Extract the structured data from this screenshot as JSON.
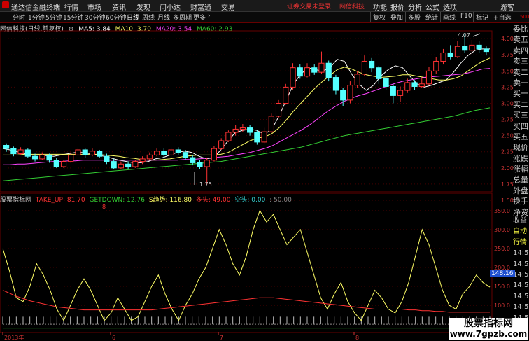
{
  "menubar": {
    "app_title": "通达信金融终端",
    "items": [
      "行情",
      "市场",
      "资讯",
      "发现",
      "问小达",
      "财富通",
      "交易"
    ],
    "notice": "证券交易未登录",
    "broker": "网信科技",
    "right_items": [
      "功能",
      "报价",
      "分析",
      "公式",
      "选项"
    ],
    "guest": "游客"
  },
  "toolbar": {
    "periods": [
      "分时",
      "1分钟",
      "5分钟",
      "15分钟",
      "30分钟",
      "60分钟",
      "日线",
      "周线",
      "月线",
      "多周期",
      "更多"
    ],
    "active_period": "日线",
    "right_buttons": [
      "复权",
      "叠加",
      "多股",
      "统计",
      "画线",
      "F10",
      "标记",
      "+自选"
    ]
  },
  "main_legend": {
    "title": "网信科技(日线,前复权)",
    "ma": [
      {
        "label": "MA5: 3.84",
        "color": "#ffffff"
      },
      {
        "label": "MA10: 3.70",
        "color": "#ffff66"
      },
      {
        "label": "MA20: 3.54",
        "color": "#ff44ff"
      },
      {
        "label": "MA60: 2.93",
        "color": "#33cc33"
      }
    ]
  },
  "price_axis": [
    "4.00",
    "3.75",
    "3.50",
    "3.25",
    "3.00",
    "2.75",
    "2.50",
    "2.25",
    "2.00",
    "1.75",
    "1.50"
  ],
  "price_annotations": {
    "high": "4.07",
    "low": "1.75"
  },
  "side_labels": [
    "委比",
    "卖五",
    "卖四",
    "卖三",
    "卖二",
    "卖一",
    "买一",
    "买二",
    "买三",
    "买四",
    "买五",
    "现价",
    "涨跌",
    "涨幅",
    "总量",
    "外盘",
    "换手",
    "净资",
    "收益"
  ],
  "side_labels_lower": [
    "自动",
    "行情",
    "14:5",
    "14:5",
    "14:5",
    "14:5",
    "14:5",
    "14:5",
    "14:5",
    "14:5"
  ],
  "top_right_mark": "500",
  "indicator_legend": {
    "name": "股票指标网",
    "items": [
      {
        "label": "TAKE_UP: 81.70",
        "color": "#ff3333"
      },
      {
        "label": "GETDOWN: 12.76",
        "color": "#33cc33"
      },
      {
        "label": "S趋势: 116.80",
        "color": "#ffff66"
      },
      {
        "label": "多头: 49.00",
        "color": "#ff3333"
      },
      {
        "label": "空头: 0.00",
        "color": "#33cccc"
      },
      {
        "label": ": 50.00",
        "color": "#888888"
      }
    ]
  },
  "indicator_axis": [
    "350.0",
    "300.0",
    "250.0",
    "200.0",
    "150.0",
    "100.0",
    "50.0"
  ],
  "indicator_current": "148.16",
  "time_axis": [
    "2013年",
    "6",
    "7",
    "8"
  ],
  "red_mark": "8",
  "watermark": {
    "line1": "股票指标网",
    "line2": "www.7gpzb.com"
  },
  "chart_data": [
    {
      "type": "candlestick",
      "title": "网信科技(日线,前复权)",
      "ylim": [
        1.5,
        4.1
      ],
      "series": [
        {
          "name": "MA5",
          "values": [
            2.3,
            2.28,
            2.25,
            2.22,
            2.2,
            2.2,
            2.19,
            2.18,
            2.2,
            2.22,
            2.24,
            2.24,
            2.22,
            2.2,
            2.18,
            2.15,
            2.12,
            2.1,
            2.08,
            2.08,
            2.1,
            2.14,
            2.16,
            2.2,
            2.24,
            2.26,
            2.24,
            2.18,
            2.14,
            2.16,
            2.28,
            2.42,
            2.55,
            2.58,
            2.6,
            2.58,
            2.52,
            2.6,
            2.8,
            3.05,
            3.3,
            3.45,
            3.55,
            3.52,
            3.5,
            3.55,
            3.68,
            3.65,
            3.45,
            3.3,
            3.2,
            3.28,
            3.42,
            3.52,
            3.58,
            3.55,
            3.42,
            3.3,
            3.25,
            3.28,
            3.32,
            3.36,
            3.48,
            3.62,
            3.74,
            3.82,
            3.84,
            3.84
          ]
        },
        {
          "name": "MA10",
          "values": [
            2.2,
            2.2,
            2.2,
            2.21,
            2.21,
            2.21,
            2.21,
            2.21,
            2.21,
            2.21,
            2.21,
            2.21,
            2.21,
            2.21,
            2.2,
            2.19,
            2.18,
            2.16,
            2.15,
            2.13,
            2.12,
            2.12,
            2.13,
            2.14,
            2.16,
            2.18,
            2.19,
            2.2,
            2.2,
            2.2,
            2.21,
            2.24,
            2.3,
            2.36,
            2.42,
            2.46,
            2.48,
            2.53,
            2.62,
            2.74,
            2.88,
            3.0,
            3.12,
            3.24,
            3.34,
            3.43,
            3.52,
            3.56,
            3.53,
            3.48,
            3.44,
            3.42,
            3.4,
            3.41,
            3.42,
            3.44,
            3.44,
            3.42,
            3.4,
            3.38,
            3.36,
            3.36,
            3.38,
            3.42,
            3.5,
            3.58,
            3.65,
            3.7
          ]
        },
        {
          "name": "MA20",
          "values": [
            2.05,
            2.05,
            2.06,
            2.06,
            2.07,
            2.08,
            2.09,
            2.1,
            2.1,
            2.11,
            2.11,
            2.12,
            2.12,
            2.12,
            2.12,
            2.12,
            2.12,
            2.12,
            2.12,
            2.12,
            2.12,
            2.12,
            2.12,
            2.12,
            2.12,
            2.13,
            2.13,
            2.14,
            2.15,
            2.16,
            2.17,
            2.18,
            2.2,
            2.22,
            2.24,
            2.27,
            2.3,
            2.34,
            2.4,
            2.46,
            2.52,
            2.58,
            2.65,
            2.73,
            2.82,
            2.9,
            2.97,
            3.03,
            3.08,
            3.12,
            3.15,
            3.19,
            3.23,
            3.27,
            3.31,
            3.34,
            3.36,
            3.38,
            3.4,
            3.41,
            3.42,
            3.43,
            3.44,
            3.45,
            3.47,
            3.5,
            3.53,
            3.54
          ]
        },
        {
          "name": "MA60",
          "values": [
            1.8,
            1.81,
            1.82,
            1.83,
            1.84,
            1.85,
            1.86,
            1.87,
            1.88,
            1.89,
            1.9,
            1.91,
            1.92,
            1.93,
            1.94,
            1.95,
            1.96,
            1.97,
            1.98,
            1.99,
            2.0,
            2.01,
            2.02,
            2.03,
            2.04,
            2.05,
            2.06,
            2.07,
            2.08,
            2.09,
            2.1,
            2.12,
            2.14,
            2.16,
            2.18,
            2.2,
            2.22,
            2.24,
            2.26,
            2.28,
            2.3,
            2.32,
            2.35,
            2.38,
            2.41,
            2.44,
            2.47,
            2.5,
            2.52,
            2.54,
            2.56,
            2.58,
            2.6,
            2.62,
            2.64,
            2.66,
            2.68,
            2.7,
            2.72,
            2.74,
            2.76,
            2.78,
            2.8,
            2.83,
            2.86,
            2.89,
            2.91,
            2.93
          ]
        }
      ],
      "candles": [
        [
          2.35,
          2.3,
          2.38,
          2.25
        ],
        [
          2.3,
          2.22,
          2.33,
          2.18
        ],
        [
          2.22,
          2.28,
          2.32,
          2.2
        ],
        [
          2.28,
          2.18,
          2.3,
          2.15
        ],
        [
          2.18,
          2.14,
          2.22,
          2.1
        ],
        [
          2.14,
          2.2,
          2.24,
          2.12
        ],
        [
          2.2,
          2.12,
          2.22,
          2.08
        ],
        [
          2.12,
          2.02,
          2.15,
          2.0
        ],
        [
          2.02,
          2.1,
          2.12,
          2.0
        ],
        [
          2.1,
          2.2,
          2.24,
          2.08
        ],
        [
          2.2,
          2.28,
          2.32,
          2.18
        ],
        [
          2.28,
          2.2,
          2.3,
          2.16
        ],
        [
          2.2,
          2.26,
          2.3,
          2.18
        ],
        [
          2.26,
          2.18,
          2.28,
          2.15
        ],
        [
          2.18,
          2.1,
          2.22,
          2.06
        ],
        [
          2.1,
          2.0,
          2.14,
          1.98
        ],
        [
          2.0,
          2.06,
          2.1,
          1.98
        ],
        [
          2.06,
          2.02,
          2.1,
          1.98
        ],
        [
          2.02,
          2.1,
          2.12,
          2.0
        ],
        [
          2.1,
          2.14,
          2.18,
          2.06
        ],
        [
          2.14,
          2.2,
          2.24,
          2.12
        ],
        [
          2.2,
          2.26,
          2.3,
          2.18
        ],
        [
          2.26,
          2.2,
          2.3,
          2.16
        ],
        [
          2.2,
          2.28,
          2.32,
          2.18
        ],
        [
          2.28,
          2.24,
          2.32,
          2.2
        ],
        [
          2.24,
          2.16,
          2.28,
          2.12
        ],
        [
          2.16,
          2.08,
          2.2,
          2.04
        ],
        [
          2.08,
          2.02,
          2.12,
          1.98
        ],
        [
          2.02,
          2.12,
          2.15,
          1.75
        ],
        [
          2.12,
          2.3,
          2.34,
          2.1
        ],
        [
          2.3,
          2.42,
          2.46,
          2.28
        ],
        [
          2.42,
          2.55,
          2.58,
          2.4
        ],
        [
          2.55,
          2.6,
          2.66,
          2.5
        ],
        [
          2.6,
          2.62,
          2.68,
          2.56
        ],
        [
          2.62,
          2.55,
          2.66,
          2.5
        ],
        [
          2.55,
          2.4,
          2.58,
          2.36
        ],
        [
          2.4,
          2.56,
          2.62,
          2.38
        ],
        [
          2.56,
          2.8,
          2.84,
          2.54
        ],
        [
          2.8,
          3.0,
          3.05,
          2.78
        ],
        [
          3.0,
          3.25,
          3.3,
          2.98
        ],
        [
          3.25,
          3.55,
          3.62,
          3.2
        ],
        [
          3.55,
          3.42,
          3.6,
          3.38
        ],
        [
          3.42,
          3.55,
          3.62,
          3.4
        ],
        [
          3.55,
          3.48,
          3.6,
          3.44
        ],
        [
          3.48,
          3.62,
          3.8,
          3.46
        ],
        [
          3.62,
          3.4,
          3.66,
          3.34
        ],
        [
          3.4,
          3.2,
          3.44,
          3.14
        ],
        [
          3.2,
          3.05,
          3.24,
          2.96
        ],
        [
          3.05,
          3.28,
          3.34,
          3.0
        ],
        [
          3.28,
          3.45,
          3.5,
          3.24
        ],
        [
          3.45,
          3.65,
          3.74,
          3.42
        ],
        [
          3.65,
          3.55,
          3.7,
          3.48
        ],
        [
          3.55,
          3.38,
          3.58,
          3.3
        ],
        [
          3.38,
          3.26,
          3.42,
          3.2
        ],
        [
          3.26,
          3.12,
          3.3,
          3.0
        ],
        [
          3.12,
          3.2,
          3.26,
          3.02
        ],
        [
          3.2,
          3.32,
          3.38,
          3.16
        ],
        [
          3.32,
          3.26,
          3.36,
          3.2
        ],
        [
          3.26,
          3.3,
          3.4,
          3.24
        ],
        [
          3.3,
          3.5,
          3.56,
          3.28
        ],
        [
          3.5,
          3.65,
          3.72,
          3.46
        ],
        [
          3.65,
          3.78,
          3.84,
          3.6
        ],
        [
          3.78,
          3.72,
          3.9,
          3.68
        ],
        [
          3.72,
          3.88,
          3.96,
          3.7
        ],
        [
          3.88,
          3.82,
          4.07,
          3.78
        ],
        [
          3.82,
          3.9,
          3.98,
          3.76
        ],
        [
          3.9,
          3.84,
          3.96,
          3.78
        ],
        [
          3.84,
          3.8,
          3.88,
          3.74
        ]
      ]
    },
    {
      "type": "line",
      "title": "股票指标网",
      "ylim": [
        30,
        370
      ],
      "series": [
        {
          "name": "S趋势",
          "values": [
            250,
            190,
            120,
            110,
            150,
            210,
            180,
            140,
            90,
            60,
            100,
            140,
            170,
            140,
            100,
            60,
            80,
            120,
            90,
            60,
            70,
            110,
            150,
            180,
            130,
            90,
            60,
            100,
            130,
            170,
            200,
            250,
            300,
            260,
            210,
            180,
            230,
            300,
            350,
            320,
            340,
            300,
            260,
            280,
            300,
            240,
            180,
            120,
            90,
            130,
            160,
            110,
            80,
            60,
            100,
            140,
            120,
            90,
            80,
            110,
            160,
            230,
            300,
            260,
            200,
            140,
            100,
            90,
            130,
            150,
            180,
            160,
            148
          ]
        },
        {
          "name": "TAKE_UP",
          "values": [
            140,
            132,
            124,
            118,
            112,
            108,
            104,
            100,
            96,
            94,
            92,
            90,
            88,
            88,
            88,
            88,
            88,
            88,
            88,
            88,
            88,
            88,
            88,
            90,
            92,
            94,
            96,
            98,
            100,
            102,
            104,
            106,
            108,
            110,
            112,
            114,
            116,
            118,
            120,
            120,
            120,
            118,
            116,
            114,
            112,
            110,
            108,
            106,
            104,
            102,
            100,
            98,
            96,
            94,
            92,
            90,
            90,
            90,
            90,
            90,
            88,
            88,
            86,
            86,
            84,
            84,
            82,
            82,
            82,
            82,
            82,
            82,
            82
          ]
        },
        {
          "name": "GETDOWN",
          "values": [
            40,
            40,
            40,
            40,
            40,
            40,
            40,
            40,
            40,
            40,
            40,
            40,
            40,
            40,
            40,
            40,
            40,
            40,
            40,
            40,
            40,
            40,
            40,
            40,
            40,
            40,
            40,
            40,
            40,
            40,
            40,
            40,
            40,
            40,
            40,
            40,
            40,
            40,
            40,
            40,
            40,
            40,
            40,
            40,
            40,
            40,
            40,
            40,
            40,
            40,
            40,
            40,
            40,
            40,
            40,
            40,
            40,
            40,
            40,
            40,
            40,
            40,
            40,
            40,
            40,
            40,
            40,
            40,
            40,
            40,
            40,
            40,
            40
          ]
        }
      ]
    }
  ]
}
